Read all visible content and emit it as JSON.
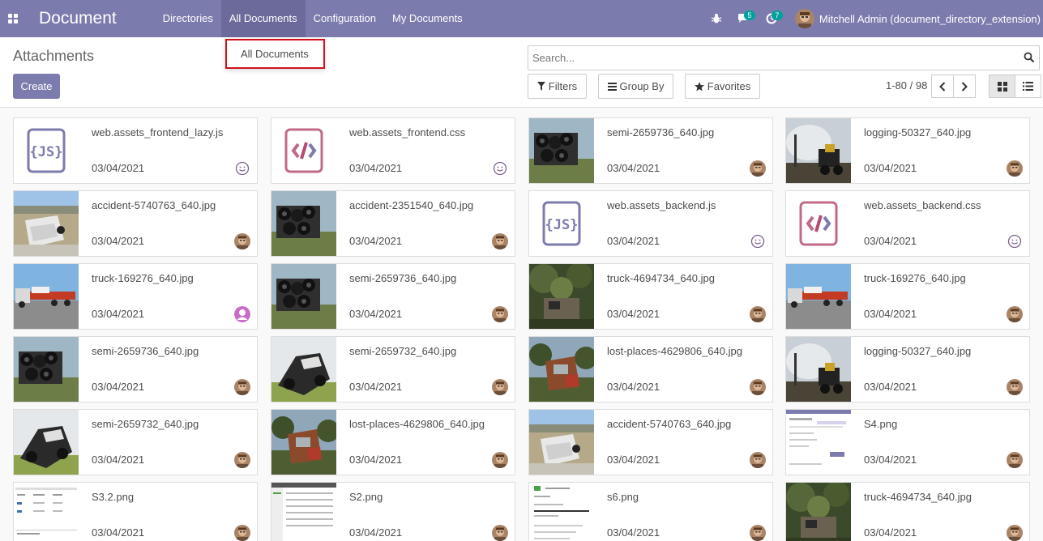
{
  "app": {
    "title": "Document",
    "menu": [
      {
        "label": "Directories",
        "active": false
      },
      {
        "label": "All Documents",
        "active": true
      },
      {
        "label": "Configuration",
        "active": false
      },
      {
        "label": "My Documents",
        "active": false
      }
    ],
    "systray": {
      "bug_icon": "bug-icon",
      "messages_count": "5",
      "activities_count": "7",
      "user_name": "Mitchell Admin (document_directory_extension)"
    }
  },
  "dropdown": {
    "item": "All Documents"
  },
  "control_panel": {
    "breadcrumb": "Attachments",
    "create_label": "Create",
    "search_placeholder": "Search...",
    "filters_label": "Filters",
    "groupby_label": "Group By",
    "favorites_label": "Favorites",
    "pager": "1-80 / 98"
  },
  "colors": {
    "brand": "#7c7bad",
    "badge": "#00a09d",
    "highlight": "#d0121b"
  },
  "cards": [
    {
      "name": "web.assets_frontend_lazy.js",
      "date": "03/04/2021",
      "thumb": "js",
      "owner": "smiley"
    },
    {
      "name": "web.assets_frontend.css",
      "date": "03/04/2021",
      "thumb": "css",
      "owner": "smiley"
    },
    {
      "name": "semi-2659736_640.jpg",
      "date": "03/04/2021",
      "thumb": "photo-tires",
      "owner": "admin"
    },
    {
      "name": "logging-50327_640.jpg",
      "date": "03/04/2021",
      "thumb": "photo-smoke",
      "owner": "admin"
    },
    {
      "name": "accident-5740763_640.jpg",
      "date": "03/04/2021",
      "thumb": "photo-accident",
      "owner": "admin"
    },
    {
      "name": "accident-2351540_640.jpg",
      "date": "03/04/2021",
      "thumb": "photo-tires",
      "owner": "admin"
    },
    {
      "name": "web.assets_backend.js",
      "date": "03/04/2021",
      "thumb": "js",
      "owner": "smiley"
    },
    {
      "name": "web.assets_backend.css",
      "date": "03/04/2021",
      "thumb": "css",
      "owner": "smiley"
    },
    {
      "name": "truck-169276_640.jpg",
      "date": "03/04/2021",
      "thumb": "photo-truck",
      "owner": "user-default"
    },
    {
      "name": "semi-2659736_640.jpg",
      "date": "03/04/2021",
      "thumb": "photo-tires",
      "owner": "admin"
    },
    {
      "name": "truck-4694734_640.jpg",
      "date": "03/04/2021",
      "thumb": "photo-forest",
      "owner": "admin"
    },
    {
      "name": "truck-169276_640.jpg",
      "date": "03/04/2021",
      "thumb": "photo-truck",
      "owner": "admin"
    },
    {
      "name": "semi-2659736_640.jpg",
      "date": "03/04/2021",
      "thumb": "photo-tires",
      "owner": "admin"
    },
    {
      "name": "semi-2659732_640.jpg",
      "date": "03/04/2021",
      "thumb": "photo-crash",
      "owner": "admin"
    },
    {
      "name": "lost-places-4629806_640.jpg",
      "date": "03/04/2021",
      "thumb": "photo-rust",
      "owner": "admin"
    },
    {
      "name": "logging-50327_640.jpg",
      "date": "03/04/2021",
      "thumb": "photo-smoke",
      "owner": "admin"
    },
    {
      "name": "semi-2659732_640.jpg",
      "date": "03/04/2021",
      "thumb": "photo-crash",
      "owner": "admin"
    },
    {
      "name": "lost-places-4629806_640.jpg",
      "date": "03/04/2021",
      "thumb": "photo-rust",
      "owner": "admin"
    },
    {
      "name": "accident-5740763_640.jpg",
      "date": "03/04/2021",
      "thumb": "photo-accident",
      "owner": "admin"
    },
    {
      "name": "S4.png",
      "date": "03/04/2021",
      "thumb": "screenshot-purple",
      "owner": "admin"
    },
    {
      "name": "S3.2.png",
      "date": "03/04/2021",
      "thumb": "screenshot-table",
      "owner": "admin"
    },
    {
      "name": "S2.png",
      "date": "03/04/2021",
      "thumb": "screenshot-list",
      "owner": "admin"
    },
    {
      "name": "s6.png",
      "date": "03/04/2021",
      "thumb": "screenshot-doc",
      "owner": "admin"
    },
    {
      "name": "truck-4694734_640.jpg",
      "date": "03/04/2021",
      "thumb": "photo-forest",
      "owner": "admin"
    }
  ]
}
